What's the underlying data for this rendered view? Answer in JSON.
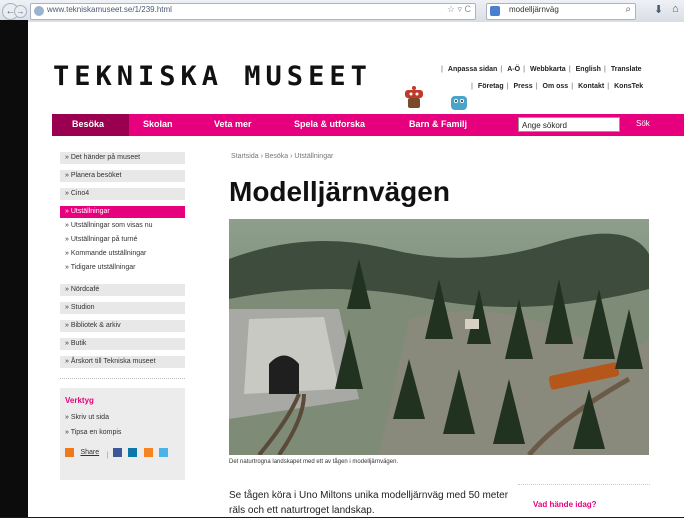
{
  "browser": {
    "url": "www.tekniskamuseet.se/1/239.html",
    "search_text": "modelljärnväg",
    "back": "←",
    "forward": "→",
    "url_controls": "☆ ▿ C",
    "search_icon": "search-icon",
    "download_icon": "download-icon",
    "home_icon": "home-icon"
  },
  "site": {
    "logo": "TEKNISKA MUSEET",
    "utility_row1": [
      "Anpassa sidan",
      "A-Ö",
      "Webbkarta",
      "English",
      "Translate"
    ],
    "utility_row2": [
      "Företag",
      "Press",
      "Om oss",
      "Kontakt",
      "KonsTek"
    ],
    "nav": [
      "Besöka",
      "Skolan",
      "Veta mer",
      "Spela & utforska",
      "Barn & Familj"
    ],
    "search_placeholder": "Ange sökord",
    "search_button": "Sök",
    "accent": "#e6007e"
  },
  "sidebar": {
    "items": [
      "» Det händer på museet",
      "» Planera besöket",
      "» Cino4",
      "» Utställningar"
    ],
    "subitems": [
      "» Utställningar som visas nu",
      "» Utställningar på turné",
      "» Kommande utställningar",
      "» Tidigare utställningar"
    ],
    "items_after": [
      "» Nördcafé",
      "» Studion",
      "» Bibliotek & arkiv",
      "» Butik",
      "» Årskort till Tekniska museet"
    ],
    "tools": {
      "title": "Verktyg",
      "links": [
        "» Skriv ut sida",
        "» Tipsa en kompis"
      ],
      "share": "Share"
    }
  },
  "main": {
    "breadcrumb": "Startsida  ›  Besöka  ›  Utställningar",
    "title": "Modelljärnvägen",
    "caption": "Det naturtrogna landskapet med ett av tågen i modelljärnvägen.",
    "intro": "Se tågen köra i Uno Miltons unika modelljärnväg med 50 meter räls och ett naturtroget landskap.",
    "aside_title": "Vad hände idag?"
  }
}
